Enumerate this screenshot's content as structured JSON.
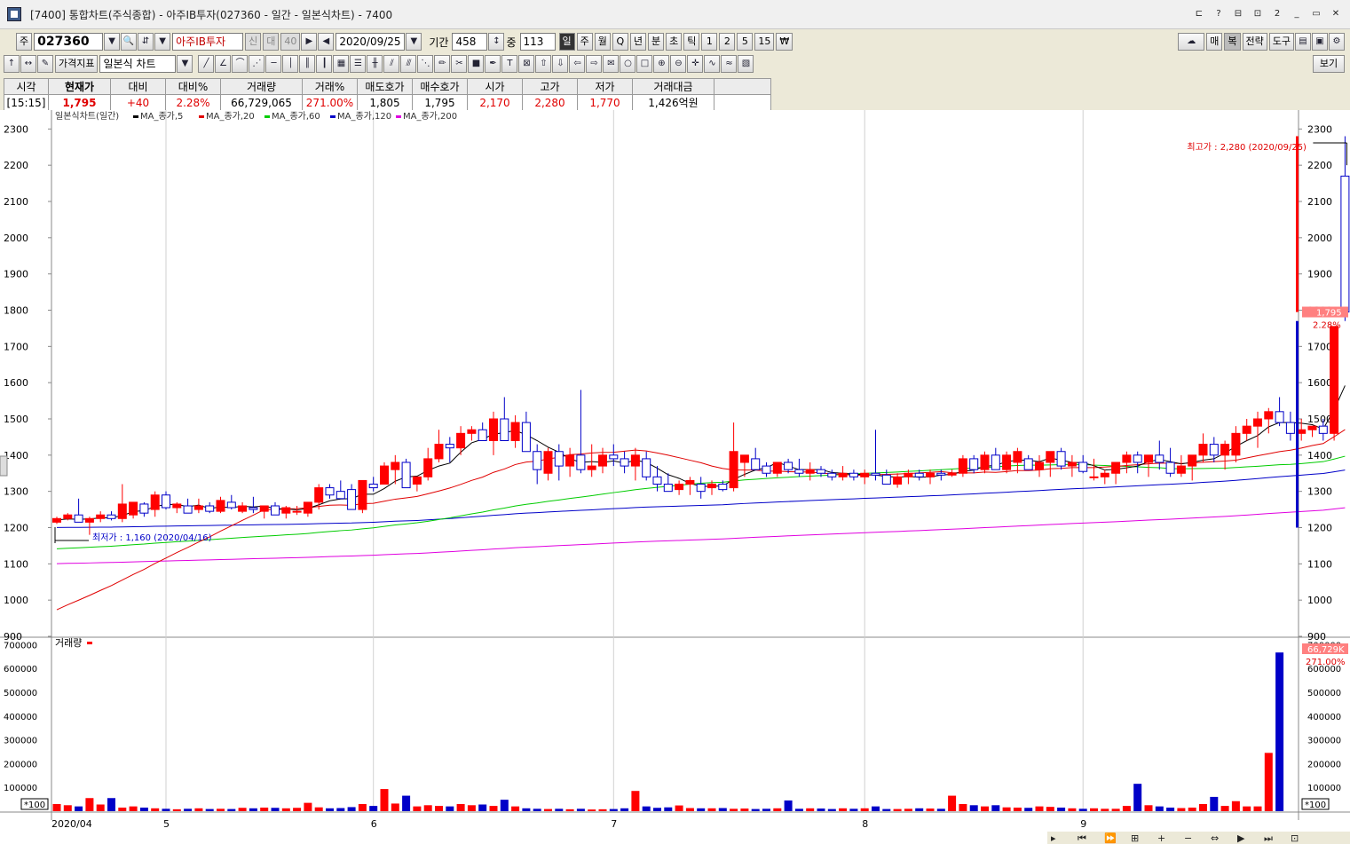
{
  "window": {
    "title": "[7400] 통합차트(주식종합) - 아주IB투자(027360 - 일간 - 일본식차트) - 7400",
    "controls": [
      "⊏",
      "?",
      "⊟",
      "⊡",
      "2",
      "_",
      "▭",
      "✕"
    ]
  },
  "toolbar1": {
    "market_label": "주",
    "stock_code": "027360",
    "stock_name": "아주IB투자",
    "badge_credit": "신",
    "badge_loan": "대",
    "badge_margin": "40",
    "date": "2020/09/25",
    "period_label": "기간",
    "period_value": "458",
    "count_label": "중",
    "count_value": "113",
    "interval_buttons": [
      "일",
      "주",
      "월",
      "Q",
      "년",
      "분",
      "초",
      "틱",
      "1",
      "2",
      "5",
      "15",
      "₩"
    ],
    "right_buttons": [
      "매",
      "복",
      "전략",
      "도구"
    ]
  },
  "toolbar2": {
    "price_indicator": "가격지표",
    "chart_type": "일본식 차트",
    "view_button": "보기"
  },
  "quote": {
    "headers": [
      "시각",
      "현재가",
      "대비",
      "대비%",
      "거래량",
      "거래%",
      "매도호가",
      "매수호가",
      "시가",
      "고가",
      "저가",
      "거래대금"
    ],
    "values": [
      "[15:15]",
      "1,795",
      "+40",
      "2.28%",
      "66,729,065",
      "271.00%",
      "1,805",
      "1,795",
      "2,170",
      "2,280",
      "1,770",
      "1,426억원"
    ]
  },
  "colors": {
    "up": "#ff0000",
    "down": "#0000c8",
    "ma5": "#000000",
    "ma20": "#e00000",
    "ma60": "#00cc00",
    "ma120": "#0000c8",
    "ma200": "#e000e0"
  },
  "legend": {
    "title": "일본식차트(일간)",
    "items": [
      "MA_종가,5",
      "MA_종가,20",
      "MA_종가,60",
      "MA_종가,120",
      "MA_종가,200"
    ]
  },
  "chart_data": {
    "type": "candlestick",
    "price_axis": {
      "ticks": [
        900,
        1000,
        1100,
        1200,
        1300,
        1400,
        1500,
        1600,
        1700,
        1800,
        1900,
        2000,
        2100,
        2200,
        2300
      ]
    },
    "volume_axis": {
      "ticks": [
        100000,
        200000,
        300000,
        400000,
        500000,
        600000,
        700000
      ],
      "unit_label": "*100",
      "label": "거래량"
    },
    "x_labels": [
      "2020/04",
      "5",
      "6",
      "7",
      "8",
      "9"
    ],
    "x_label_index": [
      0,
      10,
      29,
      51,
      74,
      94
    ],
    "annotations": {
      "high": "최고가 : 2,280 (2020/09/25)",
      "low": "최저가 : 1,160 (2020/04/16)"
    },
    "last_price": "1,795",
    "last_change": "2.28%",
    "last_volume": "66,729K",
    "last_volume_pct": "271.00%",
    "candles": [
      [
        1215,
        1230,
        1210,
        1225
      ],
      [
        1225,
        1240,
        1220,
        1235
      ],
      [
        1235,
        1280,
        1220,
        1215
      ],
      [
        1215,
        1230,
        1180,
        1225
      ],
      [
        1225,
        1245,
        1215,
        1235
      ],
      [
        1235,
        1245,
        1220,
        1225
      ],
      [
        1225,
        1320,
        1215,
        1265
      ],
      [
        1235,
        1260,
        1225,
        1270
      ],
      [
        1265,
        1270,
        1230,
        1240
      ],
      [
        1250,
        1300,
        1230,
        1290
      ],
      [
        1290,
        1300,
        1250,
        1255
      ],
      [
        1255,
        1270,
        1240,
        1265
      ],
      [
        1260,
        1280,
        1240,
        1240
      ],
      [
        1250,
        1280,
        1240,
        1260
      ],
      [
        1260,
        1270,
        1240,
        1245
      ],
      [
        1245,
        1285,
        1240,
        1275
      ],
      [
        1270,
        1290,
        1250,
        1255
      ],
      [
        1245,
        1270,
        1240,
        1260
      ],
      [
        1255,
        1285,
        1240,
        1250
      ],
      [
        1245,
        1260,
        1225,
        1260
      ],
      [
        1260,
        1270,
        1240,
        1235
      ],
      [
        1240,
        1260,
        1225,
        1255
      ],
      [
        1245,
        1260,
        1235,
        1245
      ],
      [
        1240,
        1270,
        1230,
        1270
      ],
      [
        1270,
        1320,
        1250,
        1310
      ],
      [
        1310,
        1320,
        1280,
        1290
      ],
      [
        1300,
        1330,
        1280,
        1280
      ],
      [
        1305,
        1320,
        1250,
        1250
      ],
      [
        1250,
        1270,
        1240,
        1330
      ],
      [
        1320,
        1340,
        1300,
        1310
      ],
      [
        1320,
        1380,
        1320,
        1370
      ],
      [
        1360,
        1400,
        1320,
        1380
      ],
      [
        1380,
        1390,
        1330,
        1310
      ],
      [
        1320,
        1340,
        1300,
        1340
      ],
      [
        1340,
        1420,
        1330,
        1390
      ],
      [
        1390,
        1470,
        1380,
        1430
      ],
      [
        1430,
        1450,
        1380,
        1420
      ],
      [
        1420,
        1480,
        1400,
        1460
      ],
      [
        1460,
        1480,
        1440,
        1470
      ],
      [
        1470,
        1490,
        1440,
        1440
      ],
      [
        1440,
        1520,
        1400,
        1500
      ],
      [
        1500,
        1560,
        1440,
        1440
      ],
      [
        1440,
        1510,
        1420,
        1490
      ],
      [
        1490,
        1520,
        1420,
        1410
      ],
      [
        1410,
        1430,
        1320,
        1360
      ],
      [
        1350,
        1420,
        1330,
        1410
      ],
      [
        1410,
        1430,
        1330,
        1370
      ],
      [
        1370,
        1420,
        1340,
        1400
      ],
      [
        1400,
        1580,
        1350,
        1360
      ],
      [
        1360,
        1430,
        1340,
        1370
      ],
      [
        1370,
        1420,
        1350,
        1400
      ],
      [
        1400,
        1430,
        1370,
        1390
      ],
      [
        1390,
        1410,
        1350,
        1370
      ],
      [
        1370,
        1420,
        1330,
        1400
      ],
      [
        1390,
        1410,
        1330,
        1340
      ],
      [
        1340,
        1370,
        1300,
        1320
      ],
      [
        1320,
        1350,
        1300,
        1300
      ],
      [
        1305,
        1330,
        1290,
        1320
      ],
      [
        1320,
        1340,
        1290,
        1330
      ],
      [
        1320,
        1340,
        1280,
        1300
      ],
      [
        1310,
        1330,
        1290,
        1320
      ],
      [
        1320,
        1330,
        1300,
        1305
      ],
      [
        1310,
        1490,
        1300,
        1410
      ],
      [
        1380,
        1400,
        1340,
        1400
      ],
      [
        1390,
        1420,
        1360,
        1360
      ],
      [
        1370,
        1380,
        1340,
        1350
      ],
      [
        1350,
        1380,
        1340,
        1380
      ],
      [
        1380,
        1390,
        1350,
        1360
      ],
      [
        1360,
        1390,
        1340,
        1350
      ],
      [
        1350,
        1380,
        1330,
        1360
      ],
      [
        1360,
        1370,
        1340,
        1350
      ],
      [
        1350,
        1360,
        1330,
        1340
      ],
      [
        1340,
        1370,
        1330,
        1350
      ],
      [
        1350,
        1360,
        1330,
        1340
      ],
      [
        1340,
        1360,
        1320,
        1350
      ],
      [
        1350,
        1470,
        1330,
        1345
      ],
      [
        1345,
        1360,
        1320,
        1320
      ],
      [
        1320,
        1350,
        1310,
        1340
      ],
      [
        1340,
        1360,
        1320,
        1350
      ],
      [
        1350,
        1360,
        1330,
        1340
      ],
      [
        1340,
        1360,
        1320,
        1350
      ],
      [
        1350,
        1360,
        1330,
        1345
      ],
      [
        1345,
        1360,
        1340,
        1350
      ],
      [
        1350,
        1400,
        1340,
        1390
      ],
      [
        1390,
        1400,
        1350,
        1360
      ],
      [
        1360,
        1410,
        1350,
        1400
      ],
      [
        1400,
        1420,
        1360,
        1360
      ],
      [
        1360,
        1410,
        1350,
        1400
      ],
      [
        1380,
        1420,
        1350,
        1410
      ],
      [
        1390,
        1400,
        1370,
        1360
      ],
      [
        1360,
        1400,
        1340,
        1380
      ],
      [
        1380,
        1410,
        1340,
        1410
      ],
      [
        1410,
        1420,
        1360,
        1370
      ],
      [
        1370,
        1400,
        1340,
        1380
      ],
      [
        1380,
        1400,
        1350,
        1355
      ],
      [
        1340,
        1390,
        1330,
        1340
      ],
      [
        1340,
        1360,
        1320,
        1350
      ],
      [
        1350,
        1380,
        1320,
        1380
      ],
      [
        1380,
        1410,
        1350,
        1400
      ],
      [
        1400,
        1410,
        1350,
        1380
      ],
      [
        1380,
        1400,
        1340,
        1400
      ],
      [
        1400,
        1440,
        1360,
        1380
      ],
      [
        1380,
        1420,
        1340,
        1350
      ],
      [
        1350,
        1400,
        1340,
        1370
      ],
      [
        1370,
        1400,
        1330,
        1400
      ],
      [
        1400,
        1460,
        1380,
        1430
      ],
      [
        1430,
        1450,
        1380,
        1400
      ],
      [
        1400,
        1440,
        1360,
        1430
      ],
      [
        1400,
        1480,
        1380,
        1460
      ],
      [
        1460,
        1500,
        1440,
        1480
      ],
      [
        1480,
        1520,
        1420,
        1500
      ],
      [
        1500,
        1530,
        1460,
        1520
      ],
      [
        1520,
        1560,
        1480,
        1490
      ],
      [
        1490,
        1520,
        1440,
        1460
      ],
      [
        1460,
        1500,
        1440,
        1470
      ],
      [
        1470,
        1480,
        1450,
        1480
      ],
      [
        1480,
        1500,
        1440,
        1460
      ],
      [
        1460,
        1500,
        1440,
        1755
      ],
      [
        2170,
        2280,
        1770,
        1795
      ]
    ],
    "volumes": [
      30000,
      25000,
      20000,
      55000,
      28000,
      55000,
      15000,
      20000,
      15000,
      12000,
      10000,
      8000,
      10000,
      12000,
      9000,
      10000,
      9000,
      14000,
      12000,
      15000,
      14000,
      12000,
      14000,
      35000,
      16000,
      12000,
      13000,
      17000,
      30000,
      22000,
      93000,
      32000,
      65000,
      20000,
      25000,
      22000,
      20000,
      30000,
      25000,
      28000,
      22000,
      48000,
      20000,
      12000,
      10000,
      9000,
      10000,
      8000,
      10000,
      7000,
      8000,
      9000,
      12000,
      85000,
      20000,
      14000,
      16000,
      24000,
      13000,
      12000,
      12000,
      13000,
      10000,
      11000,
      9000,
      10000,
      12000,
      45000,
      10000,
      12000,
      11000,
      9000,
      12000,
      10000,
      12000,
      20000,
      9000,
      9000,
      10000,
      12000,
      11000,
      10000,
      65000,
      30000,
      25000,
      20000,
      25000,
      16000,
      15000,
      14000,
      20000,
      18000,
      15000,
      12000,
      10000,
      12000,
      10000,
      10000,
      22000,
      115000,
      25000,
      20000,
      15000,
      13000,
      15000,
      30000,
      60000,
      22000,
      42000,
      20000,
      20000,
      245000,
      667000
    ]
  }
}
